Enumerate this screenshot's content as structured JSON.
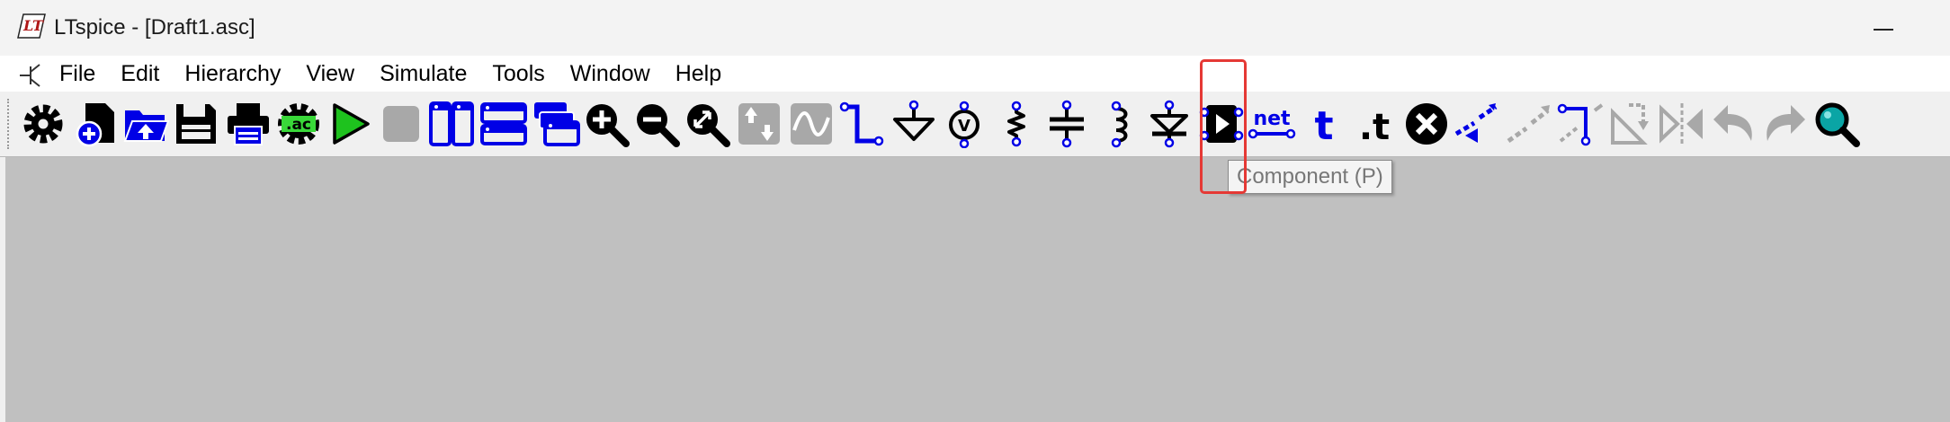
{
  "window": {
    "title": "LTspice - [Draft1.asc]",
    "logo_text": "LT"
  },
  "menu": {
    "items": [
      "File",
      "Edit",
      "Hierarchy",
      "View",
      "Simulate",
      "Tools",
      "Window",
      "Help"
    ]
  },
  "toolbar": {
    "buttons": [
      {
        "name": "settings-button",
        "icon": "gear-icon",
        "enabled": true
      },
      {
        "name": "new-schematic-button",
        "icon": "new-document-icon",
        "enabled": true
      },
      {
        "name": "open-button",
        "icon": "open-folder-icon",
        "enabled": true
      },
      {
        "name": "save-button",
        "icon": "save-icon",
        "enabled": true
      },
      {
        "name": "print-button",
        "icon": "printer-icon",
        "enabled": true
      },
      {
        "name": "edit-simulation-command-button",
        "icon": "ac-gear-icon",
        "enabled": true,
        "label": ".ac"
      },
      {
        "name": "run-button",
        "icon": "play-icon",
        "enabled": true
      },
      {
        "name": "halt-button",
        "icon": "stop-icon",
        "enabled": false
      },
      {
        "name": "tile-vertical-button",
        "icon": "tile-vertical-icon",
        "enabled": true
      },
      {
        "name": "tile-horizontal-button",
        "icon": "tile-horizontal-icon",
        "enabled": true
      },
      {
        "name": "cascade-button",
        "icon": "cascade-icon",
        "enabled": true
      },
      {
        "name": "zoom-in-button",
        "icon": "zoom-in-icon",
        "enabled": true
      },
      {
        "name": "zoom-out-button",
        "icon": "zoom-out-icon",
        "enabled": true
      },
      {
        "name": "zoom-fit-button",
        "icon": "zoom-fit-icon",
        "enabled": true
      },
      {
        "name": "autorange-button",
        "icon": "autorange-icon",
        "enabled": false
      },
      {
        "name": "waveform-button",
        "icon": "waveform-icon",
        "enabled": false
      },
      {
        "name": "wire-button",
        "icon": "wire-icon",
        "enabled": true
      },
      {
        "name": "ground-button",
        "icon": "ground-icon",
        "enabled": true
      },
      {
        "name": "voltage-source-button",
        "icon": "voltage-source-icon",
        "enabled": true
      },
      {
        "name": "resistor-button",
        "icon": "resistor-icon",
        "enabled": true
      },
      {
        "name": "capacitor-button",
        "icon": "capacitor-icon",
        "enabled": true
      },
      {
        "name": "inductor-button",
        "icon": "inductor-icon",
        "enabled": true
      },
      {
        "name": "diode-button",
        "icon": "diode-icon",
        "enabled": true
      },
      {
        "name": "component-button",
        "icon": "component-icon",
        "enabled": true
      },
      {
        "name": "net-label-button",
        "icon": "net-label-icon",
        "enabled": true,
        "label": "net"
      },
      {
        "name": "text-button",
        "icon": "text-icon",
        "enabled": true,
        "label": "t"
      },
      {
        "name": "spice-directive-button",
        "icon": "spice-directive-icon",
        "enabled": true,
        "label": ".t"
      },
      {
        "name": "delete-button",
        "icon": "delete-icon",
        "enabled": true
      },
      {
        "name": "duplicate-button",
        "icon": "duplicate-icon",
        "enabled": true
      },
      {
        "name": "move-button",
        "icon": "move-icon",
        "enabled": false
      },
      {
        "name": "drag-button",
        "icon": "drag-icon",
        "enabled": true
      },
      {
        "name": "rotate-button",
        "icon": "rotate-icon",
        "enabled": false
      },
      {
        "name": "mirror-button",
        "icon": "mirror-icon",
        "enabled": false
      },
      {
        "name": "undo-button",
        "icon": "undo-icon",
        "enabled": false
      },
      {
        "name": "redo-button",
        "icon": "redo-icon",
        "enabled": false
      },
      {
        "name": "find-button",
        "icon": "find-icon",
        "enabled": true
      }
    ]
  },
  "tooltip": {
    "text": "Component (P)"
  },
  "colors": {
    "icon_black": "#000000",
    "icon_blue": "#0000e6",
    "icon_disabled": "#a8a8a8",
    "run_green": "#1ec21e",
    "ac_green": "#39d839",
    "find_teal": "#0aa5a5",
    "workspace": "#c0c0c0",
    "highlight": "#e53935"
  }
}
